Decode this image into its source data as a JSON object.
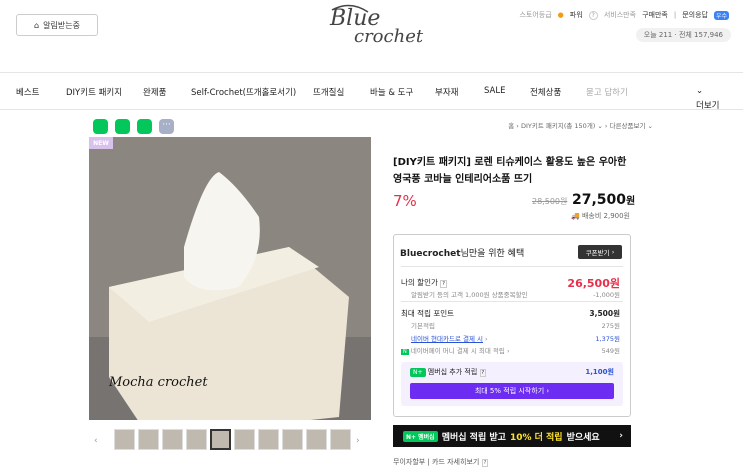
{
  "header": {
    "alarm_label": "알림받는중",
    "logo_line1": "Blue",
    "logo_line2": "crochet",
    "top_links": {
      "store_grade": "스토어등급",
      "grade_value": "파워",
      "service_satisfaction": "서비스만족",
      "purchase_satisfaction": "구매만족",
      "divider": "|",
      "inquiry": "문의응답",
      "inquiry_badge": "우수"
    },
    "visitors": "오늘 211 · 전체 157,946"
  },
  "nav": {
    "items": [
      "베스트",
      "DIY키트 패키지",
      "완제품",
      "Self-Crochet(뜨개홀로서기)",
      "뜨개질실",
      "바늘 & 도구",
      "부자재",
      "SALE",
      "전체상품",
      "묻고 답하기"
    ],
    "more": "더보기"
  },
  "breadcrumb": {
    "home": "홈",
    "category": "DIY키트 패키지(총 150개)",
    "other": "다른상품보기"
  },
  "image": {
    "new_tag": "NEW",
    "watermark": "Mocha crochet",
    "thumb_count": 10
  },
  "product": {
    "title": "[DIY키트 패키지] 로렌 티슈케이스 활용도 높은 우아한 영국풍 코바늘 인테리어소품 뜨기",
    "discount": "7%",
    "original_price": "28,500원",
    "price": "27,500",
    "price_unit": "원",
    "shipping": "배송비 2,900원"
  },
  "benefit": {
    "heading_bold": "Bluecrochet",
    "heading_rest": "님만을 위한 혜택",
    "coupon_button": "쿠폰받기",
    "my_price_label": "나의 할인가",
    "my_price": "26,500원",
    "alarm_discount_label": "알림받기 등의 고객 1,000원 상품중복할인",
    "alarm_discount_value": "-1,000원",
    "max_points_label": "최대 적립 포인트",
    "max_points_value": "3,500원",
    "basic_points_label": "기본적립",
    "basic_points_value": "275원",
    "card_label": "네이버 현대카드로 결제 시",
    "card_value": "1,375원",
    "money_label": "네이버페이 머니 결제 시 최대 적립",
    "money_value": "549원",
    "member_label": "멤버십 추가 적립",
    "member_value": "1,100원",
    "member_button": "최대 5% 적립 시작하기"
  },
  "banner": {
    "tag": "N+ 멤버십",
    "text_pre": "멤버십 적립 받고",
    "text_highlight": "10% 더 적립",
    "text_post": "받으세요"
  },
  "footer_text": {
    "installment": "무이자할부",
    "card_detail": "카드 자세히보기",
    "help": "?"
  }
}
